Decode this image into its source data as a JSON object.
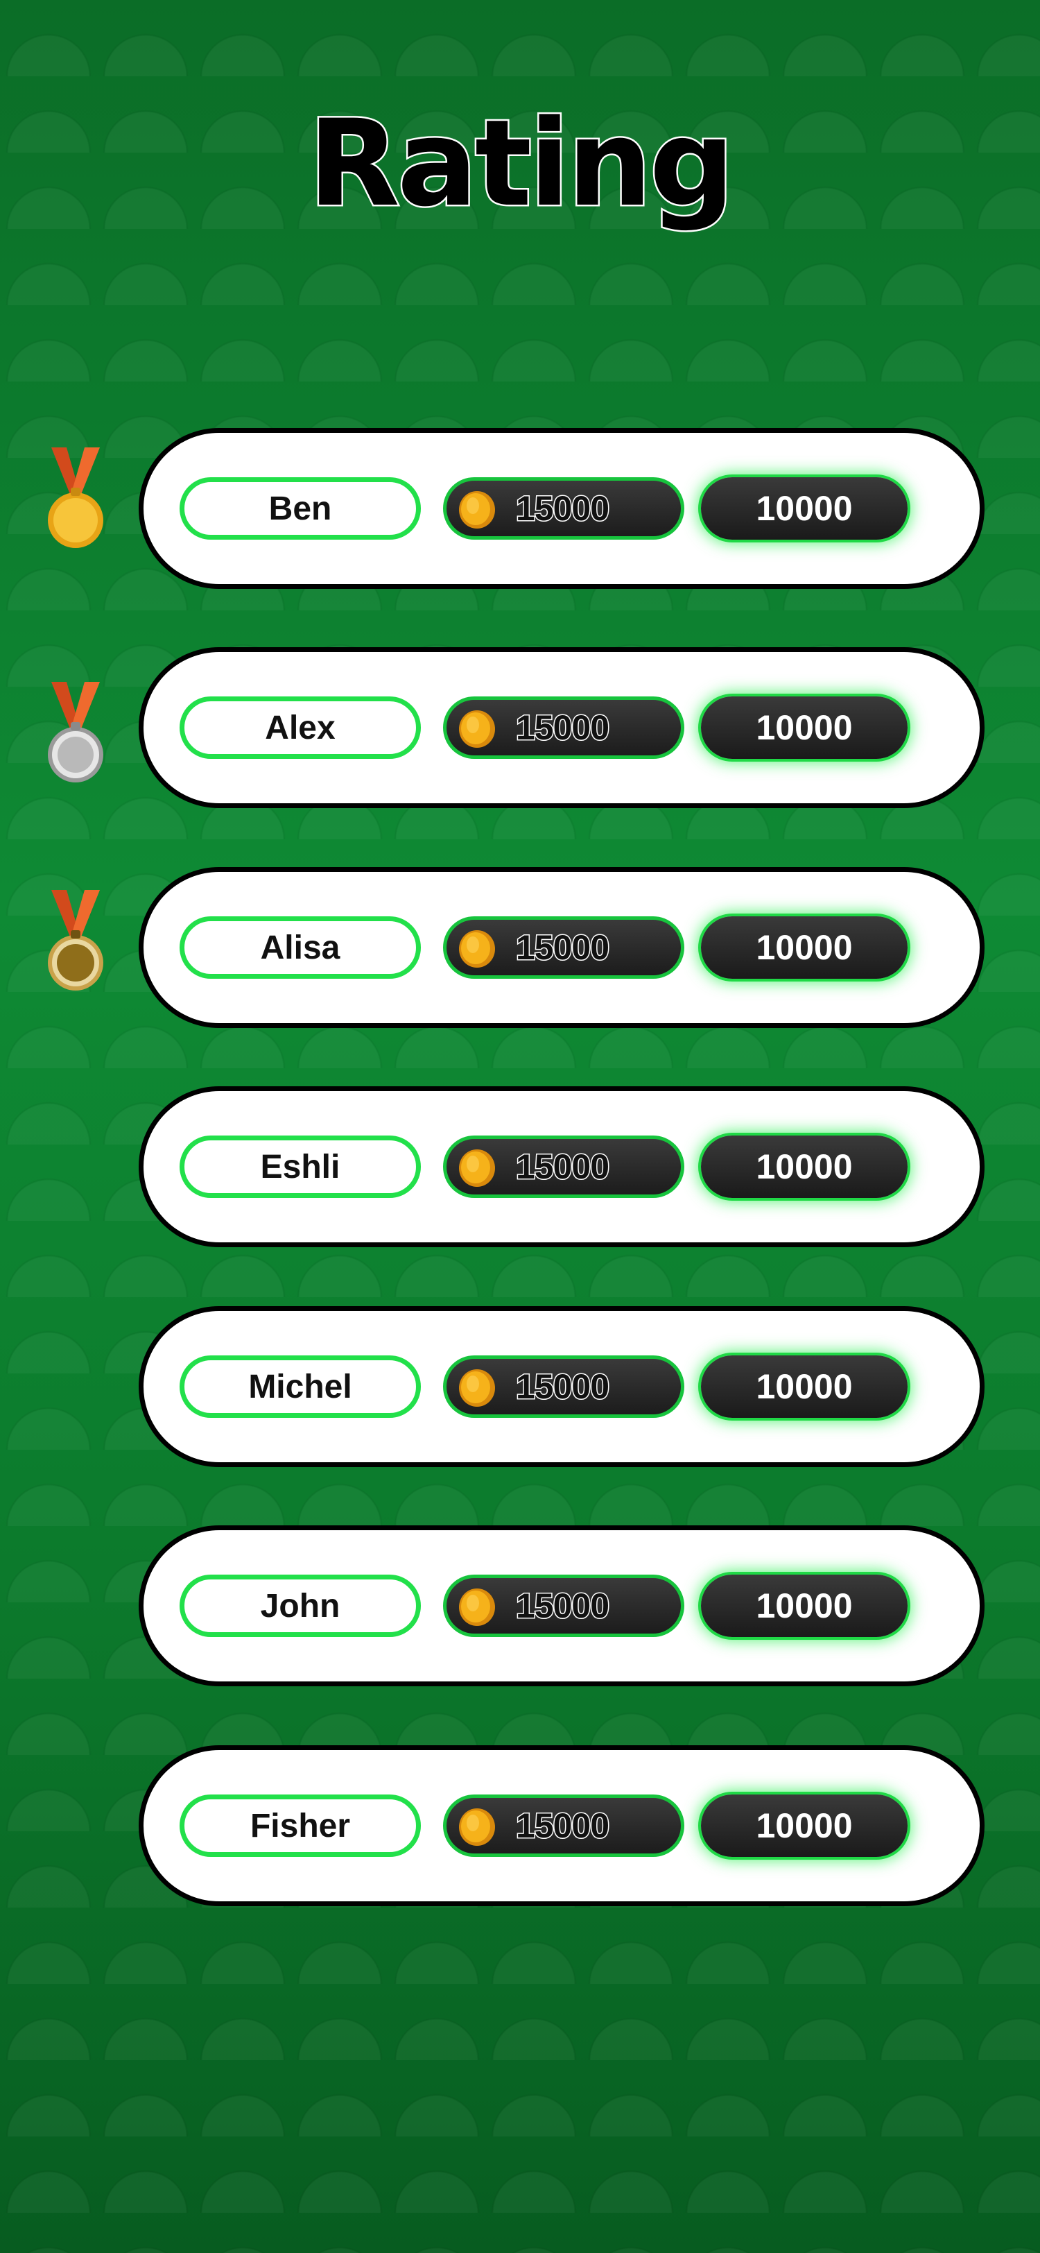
{
  "title": "Rating",
  "colors": {
    "background": "#0c7a2c",
    "accent_green": "#22e04a",
    "row_fill": "#ffffff",
    "gold": "#f2b320",
    "silver": "#c8c8c8",
    "bronze": "#9c7a1f",
    "ribbon": "#e0552a"
  },
  "rows": [
    {
      "name": "Ben",
      "coins": "15000",
      "score": "10000",
      "medal": "gold-medal-icon"
    },
    {
      "name": "Alex",
      "coins": "15000",
      "score": "10000",
      "medal": "silver-medal-icon"
    },
    {
      "name": "Alisa",
      "coins": "15000",
      "score": "10000",
      "medal": "bronze-medal-icon"
    },
    {
      "name": "Eshli",
      "coins": "15000",
      "score": "10000",
      "medal": ""
    },
    {
      "name": "Michel",
      "coins": "15000",
      "score": "10000",
      "medal": ""
    },
    {
      "name": "John",
      "coins": "15000",
      "score": "10000",
      "medal": ""
    },
    {
      "name": "Fisher",
      "coins": "15000",
      "score": "10000",
      "medal": ""
    }
  ]
}
